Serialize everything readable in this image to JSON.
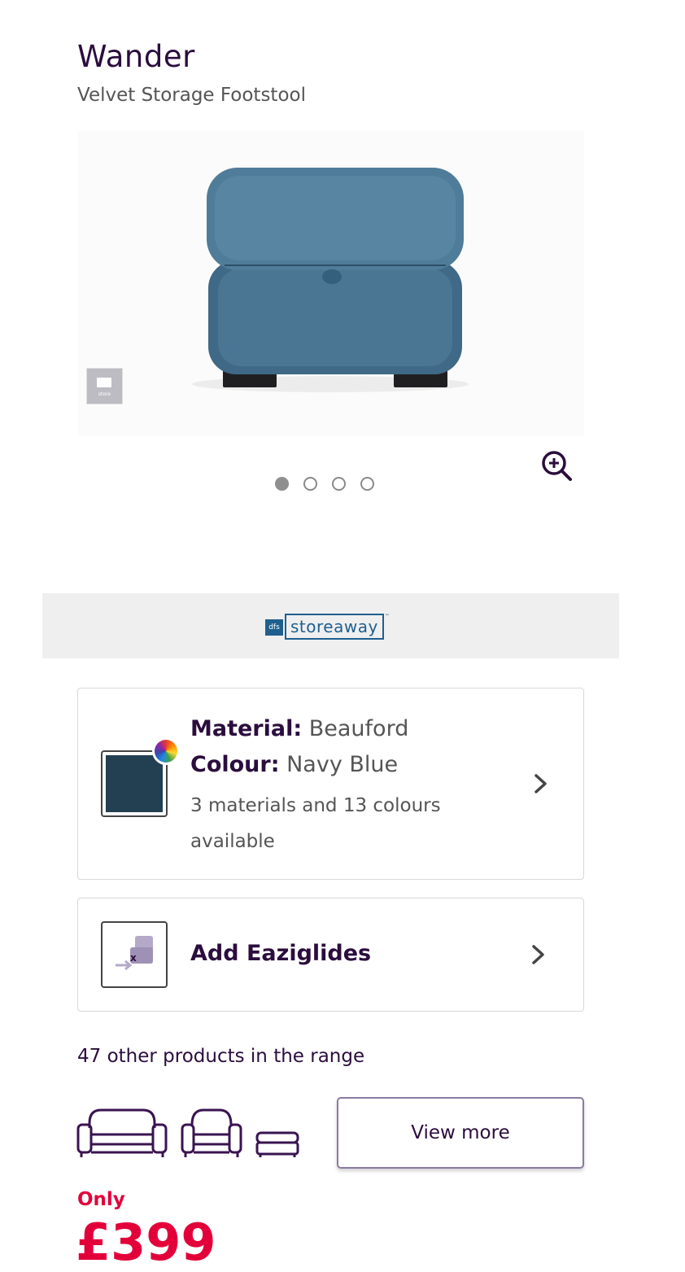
{
  "product": {
    "name": "Wander",
    "subtitle": "Velvet Storage Footstool"
  },
  "gallery": {
    "store_thumb_caption": "store",
    "dots": [
      {
        "active": true
      },
      {
        "active": false
      },
      {
        "active": false
      },
      {
        "active": false
      }
    ],
    "zoom_icon": "zoom-in-icon"
  },
  "banner": {
    "logo_brand": "dfs",
    "logo_word": "storeaway",
    "logo_tm": "™"
  },
  "material_card": {
    "material_label": "Material:",
    "material_value": "Beauford",
    "colour_label": "Colour:",
    "colour_value": "Navy Blue",
    "availability": "3 materials and 13 colours available",
    "swatch_color": "#233f52",
    "icon": "chevron-right-icon"
  },
  "glides_card": {
    "label": "Add Eaziglides",
    "icon": "chevron-right-icon"
  },
  "range": {
    "text": "47 other products in the range",
    "view_more_label": "View more",
    "icons": [
      "sofa-icon",
      "armchair-icon",
      "footstool-icon"
    ]
  },
  "price": {
    "prefix": "Only",
    "value": "£399",
    "color": "#e3003a"
  }
}
